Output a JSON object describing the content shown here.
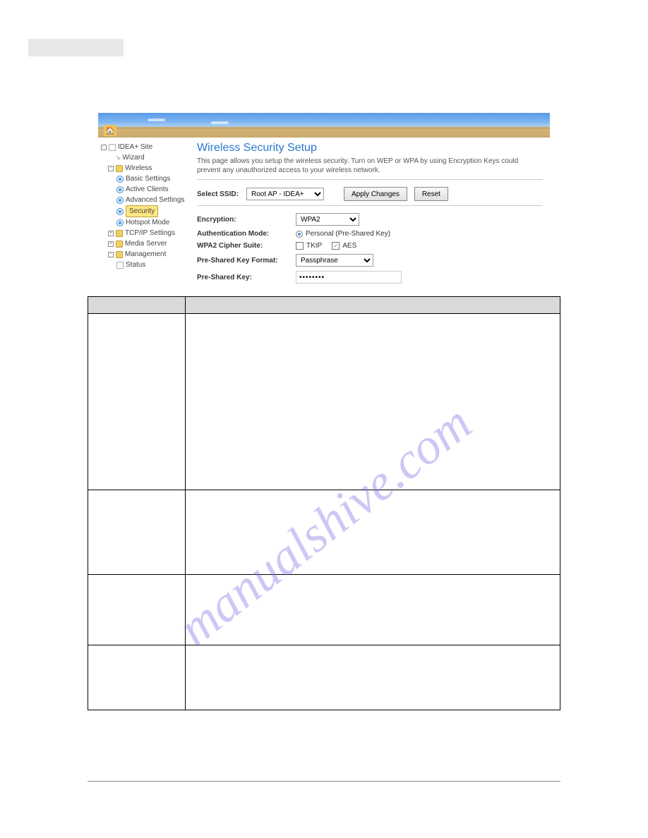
{
  "watermark": "manualshive.com",
  "nav": {
    "root": "IDEA+ Site",
    "wizard": "Wizard",
    "wireless": "Wireless",
    "basic": "Basic Settings",
    "active": "Active Clients",
    "advanced": "Advanced Settings",
    "security": "Security",
    "hotspot": "Hotspot Mode",
    "tcpip": "TCP/IP Settings",
    "media": "Media Server",
    "mgmt": "Management",
    "status": "Status"
  },
  "page": {
    "title": "Wireless Security Setup",
    "desc": "This page allows you setup the wireless security. Turn on WEP or WPA by using Encryption Keys could prevent any unauthorized access to your wireless network.",
    "select_ssid_label": "Select SSID:",
    "select_ssid_value": "Root AP - IDEA+",
    "apply_btn": "Apply Changes",
    "reset_btn": "Reset"
  },
  "form": {
    "encryption_label": "Encryption:",
    "encryption_value": "WPA2",
    "auth_label": "Authentication Mode:",
    "auth_value": "Personal (Pre-Shared Key)",
    "cipher_label": "WPA2 Cipher Suite:",
    "cipher_tkip": "TKIP",
    "cipher_aes": "AES",
    "pskfmt_label": "Pre-Shared Key Format:",
    "pskfmt_value": "Passphrase",
    "psk_label": "Pre-Shared Key:",
    "psk_value": "••••••••"
  },
  "table": {
    "header_label": "",
    "header_desc": "",
    "rows": [
      {
        "label": "",
        "desc": ""
      },
      {
        "label": "",
        "desc": ""
      },
      {
        "label": "",
        "desc": ""
      },
      {
        "label": "",
        "desc": ""
      }
    ]
  },
  "chart_data": null
}
